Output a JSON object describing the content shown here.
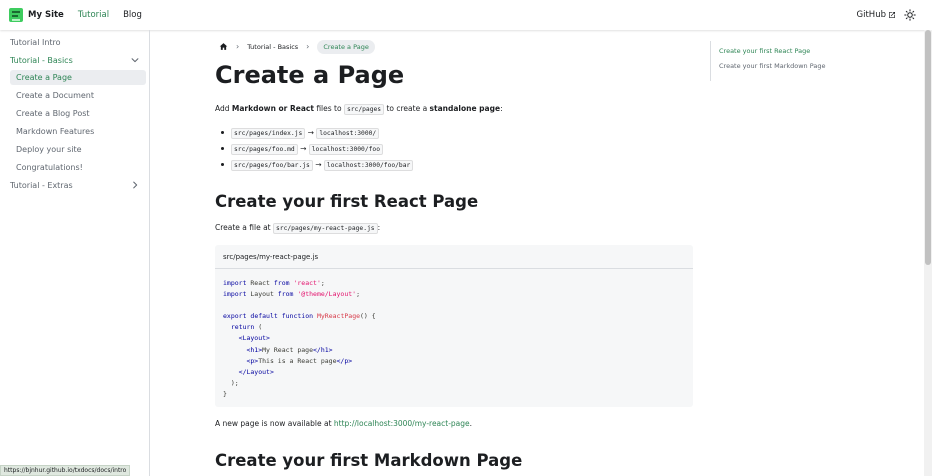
{
  "navbar": {
    "brand_title": "My Site",
    "links": [
      "Tutorial",
      "Blog"
    ],
    "github_label": "GitHub",
    "accent": "#2e8555"
  },
  "sidebar": {
    "items": [
      {
        "label": "Tutorial Intro"
      },
      {
        "label": "Tutorial - Basics"
      },
      {
        "label": "Create a Page"
      },
      {
        "label": "Create a Document"
      },
      {
        "label": "Create a Blog Post"
      },
      {
        "label": "Markdown Features"
      },
      {
        "label": "Deploy your site"
      },
      {
        "label": "Congratulations!"
      },
      {
        "label": "Tutorial - Extras"
      }
    ]
  },
  "breadcrumbs": {
    "items": [
      "Tutorial - Basics",
      "Create a Page"
    ]
  },
  "main": {
    "h1": "Create a Page",
    "intro": {
      "t1": "Add ",
      "b1": "Markdown or React",
      "t2": " files to ",
      "code": "src/pages",
      "t3": " to create a ",
      "b2": "standalone page",
      "t4": ":"
    },
    "list": [
      {
        "src": "src/pages/index.js",
        "arrow": "→",
        "dest": "localhost:3000/"
      },
      {
        "src": "src/pages/foo.md",
        "arrow": "→",
        "dest": "localhost:3000/foo"
      },
      {
        "src": "src/pages/foo/bar.js",
        "arrow": "→",
        "dest": "localhost:3000/foo/bar"
      }
    ],
    "h2_react": "Create your first React Page",
    "create_file": {
      "text": "Create a file at ",
      "code": "src/pages/my-react-page.js",
      "end": ":"
    },
    "code_title": "src/pages/my-react-page.js",
    "code_lines": [
      "import React from 'react';",
      "import Layout from '@theme/Layout';",
      "",
      "export default function MyReactPage() {",
      "  return (",
      "    <Layout>",
      "      <h1>My React page</h1>",
      "      <p>This is a React page</p>",
      "    </Layout>",
      "  );",
      "}"
    ],
    "available": {
      "text": "A new page is now available at ",
      "link": "http://localhost:3000/my-react-page",
      "end": "."
    },
    "h2_markdown": "Create your first Markdown Page"
  },
  "toc": {
    "items": [
      "Create your first React Page",
      "Create your first Markdown Page"
    ]
  },
  "statusbar": {
    "url": "https://bjnhur.github.io/txdocs/docs/intro"
  }
}
